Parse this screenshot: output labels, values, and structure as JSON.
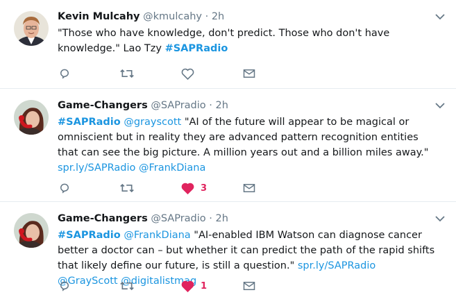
{
  "colors": {
    "link": "#1b95e0",
    "like_active": "#e0245e",
    "icon": "#657786",
    "divider": "#e6ecf0"
  },
  "tweets": [
    {
      "avatar_icon": "avatar-kevin",
      "name": "Kevin Mulcahy",
      "handle": "@kmulcahy",
      "separator": "·",
      "time": "2h",
      "text_quote": "\"Those who have knowledge, don't predict. Those who don't have knowledge.\" Lao Tzy ",
      "hashtag": "#SAPRadio",
      "liked": false,
      "like_count": ""
    },
    {
      "avatar_icon": "avatar-game-changers",
      "name": "Game-Changers",
      "handle": "@SAPradio",
      "separator": "·",
      "time": "2h",
      "hashtag": "#SAPRadio",
      "mention": "@grayscott",
      "text_quote": " \"AI of the future will appear to be magical or omniscient but in reality they are advanced pattern recognition entities that can see the big picture. A million years out and a billion miles away.\" ",
      "link": "spr.ly/SAPRadio",
      "mention2": "@FrankDiana",
      "liked": true,
      "like_count": "3"
    },
    {
      "avatar_icon": "avatar-game-changers",
      "name": "Game-Changers",
      "handle": "@SAPradio",
      "separator": "·",
      "time": "2h",
      "hashtag": "#SAPRadio",
      "mention": "@FrankDiana",
      "text_quote": " \"AI-enabled IBM Watson can diagnose cancer better a doctor can – but whether it can predict the path of the rapid shifts that likely define our future, is still a question.\" ",
      "link": "spr.ly/SAPRadio",
      "mention2": "@GrayScott",
      "mention3": "@digitalistmag",
      "liked": true,
      "like_count": "1"
    }
  ]
}
